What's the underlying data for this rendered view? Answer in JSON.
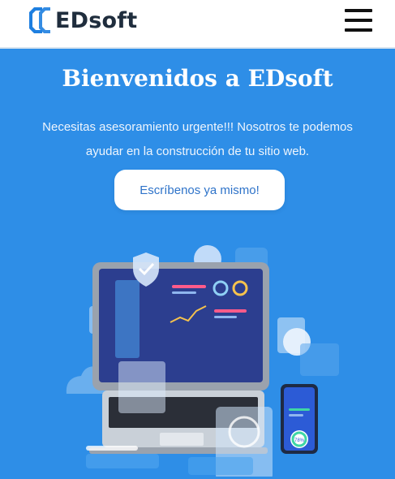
{
  "brand": {
    "name": "EDsoft"
  },
  "header": {
    "menu_icon": "hamburger-menu-icon"
  },
  "hero": {
    "title": "Bienvenidos a EDsoft",
    "description": "Necesitas asesoramiento urgente!!! Nosotros te podemos ayudar en la construcción de tu sitio web.",
    "cta_label": "Escríbenos ya mismo!"
  },
  "illustration": {
    "phone_percent": "78%"
  },
  "colors": {
    "header_bg": "#ffffff",
    "hero_bg": "#2e8ee7",
    "logo_blue": "#1e7fe0",
    "cta_text": "#2e73c9"
  }
}
